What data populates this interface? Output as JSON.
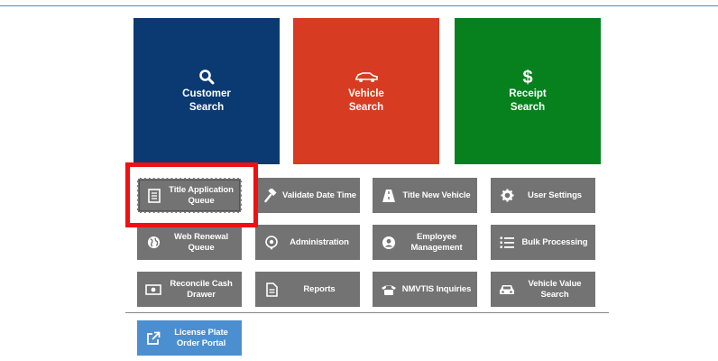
{
  "tiles": [
    {
      "line1": "Customer",
      "line2": "Search",
      "icon": "search-icon",
      "color": "#0b3a72"
    },
    {
      "line1": "Vehicle",
      "line2": "Search",
      "icon": "car-icon",
      "color": "#d73c22"
    },
    {
      "line1": "Receipt",
      "line2": "Search",
      "icon": "dollar-icon",
      "color": "#07811d"
    }
  ],
  "buttons": {
    "title_application_queue": "Title Application Queue",
    "validate_date_time": "Validate Date Time",
    "title_new_vehicle": "Title New Vehicle",
    "user_settings": "User Settings",
    "web_renewal_queue": "Web Renewal Queue",
    "administration": "Administration",
    "employee_management": "Employee Management",
    "bulk_processing": "Bulk Processing",
    "reconcile_cash_drawer": "Reconcile Cash Drawer",
    "reports": "Reports",
    "nmvtis_inquiries": "NMVTIS Inquiries",
    "vehicle_value_search": "Vehicle Value Search",
    "license_plate_order_portal": "License Plate Order Portal"
  },
  "colors": {
    "button_gray": "#737373",
    "button_blue": "#4c8fd0",
    "highlight_red": "#ee1111",
    "accent_rule": "#3b8fd4"
  }
}
